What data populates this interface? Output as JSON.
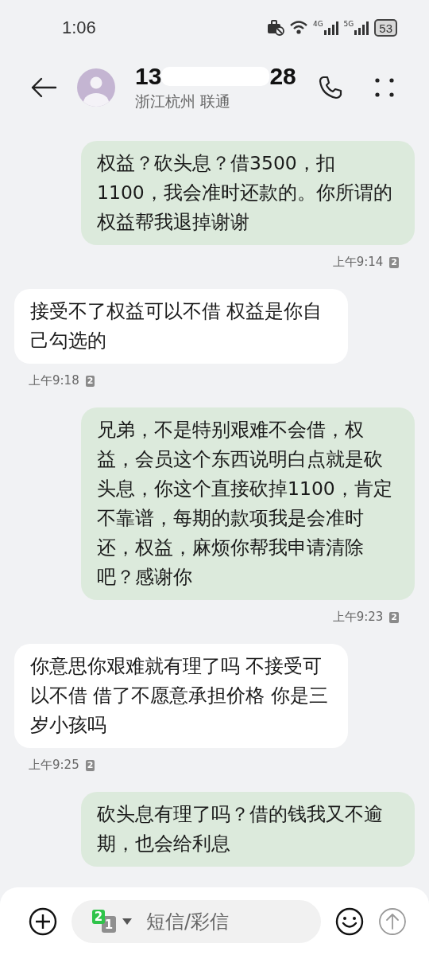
{
  "status_bar": {
    "time": "1:06",
    "network_4g": "4G",
    "network_5g": "5G",
    "battery": "53"
  },
  "header": {
    "number_start": "13",
    "number_end": "28",
    "location": "浙江杭州 联通"
  },
  "messages": [
    {
      "kind": "outgoing",
      "text": "权益？砍头息？借3500，扣1100，我会准时还款的。你所谓的权益帮我退掉谢谢",
      "time": "上午9:14",
      "sim": "2"
    },
    {
      "kind": "incoming",
      "text": "接受不了权益可以不借 权益是你自己勾选的",
      "time": "上午9:18",
      "sim": "2"
    },
    {
      "kind": "outgoing",
      "text": "兄弟，不是特别艰难不会借，权益，会员这个东西说明白点就是砍头息，你这个直接砍掉1100，肯定不靠谱，每期的款项我是会准时还，权益，麻烦你帮我申请清除吧？感谢你",
      "time": "上午9:23",
      "sim": "2"
    },
    {
      "kind": "incoming",
      "text": "你意思你艰难就有理了吗 不接受可以不借 借了不愿意承担价格 你是三岁小孩吗",
      "time": "上午9:25",
      "sim": "2"
    },
    {
      "kind": "outgoing",
      "text": "砍头息有理了吗？借的钱我又不逾期，也会给利息"
    }
  ],
  "composer": {
    "sim_primary": "2",
    "sim_secondary": "1",
    "placeholder": "短信/彩信",
    "send_disabled": true
  }
}
